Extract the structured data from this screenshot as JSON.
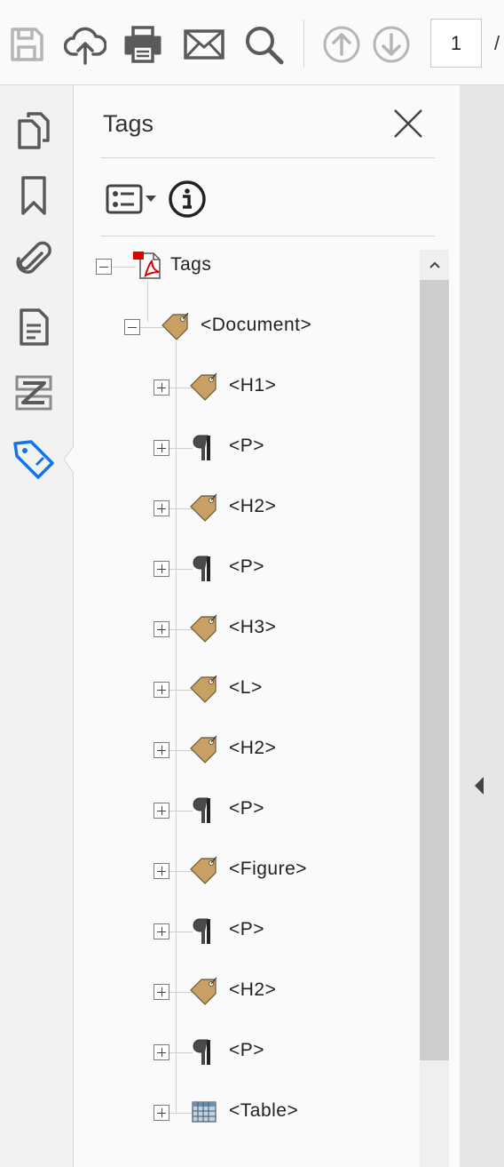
{
  "toolbar": {
    "tools": [
      {
        "name": "save-icon"
      },
      {
        "name": "upload-cloud-icon"
      },
      {
        "name": "print-icon"
      },
      {
        "name": "email-icon"
      },
      {
        "name": "search-icon"
      },
      {
        "name": "page-up-icon"
      },
      {
        "name": "page-down-icon"
      }
    ],
    "page_number": "1",
    "page_separator": "/"
  },
  "rail": {
    "items": [
      {
        "name": "page-thumbnails-icon"
      },
      {
        "name": "bookmark-icon"
      },
      {
        "name": "attachment-icon"
      },
      {
        "name": "document-icon"
      },
      {
        "name": "order-icon"
      },
      {
        "name": "tag-icon",
        "active": true
      }
    ]
  },
  "panel": {
    "title": "Tags",
    "close_icon": "close-icon",
    "options_icon": "options-menu-icon",
    "info_icon": "info-icon"
  },
  "tree": {
    "root": {
      "label": "Tags",
      "icon": "pdf-icon",
      "expanded": true
    },
    "document": {
      "label": "<Document>",
      "icon": "tag-icon",
      "expanded": true
    },
    "children": [
      {
        "label": "<H1>",
        "icon": "tag"
      },
      {
        "label": "<P>",
        "icon": "pilcrow"
      },
      {
        "label": "<H2>",
        "icon": "tag"
      },
      {
        "label": "<P>",
        "icon": "pilcrow"
      },
      {
        "label": "<H3>",
        "icon": "tag"
      },
      {
        "label": "<L>",
        "icon": "tag"
      },
      {
        "label": "<H2>",
        "icon": "tag"
      },
      {
        "label": "<P>",
        "icon": "pilcrow"
      },
      {
        "label": "<Figure>",
        "icon": "tag"
      },
      {
        "label": "<P>",
        "icon": "pilcrow"
      },
      {
        "label": "<H2>",
        "icon": "tag"
      },
      {
        "label": "<P>",
        "icon": "pilcrow"
      },
      {
        "label": "<Table>",
        "icon": "table"
      }
    ]
  },
  "colors": {
    "accent": "#1473e6",
    "tag": "#c8a064",
    "icon_gray": "#5a5a5a"
  }
}
